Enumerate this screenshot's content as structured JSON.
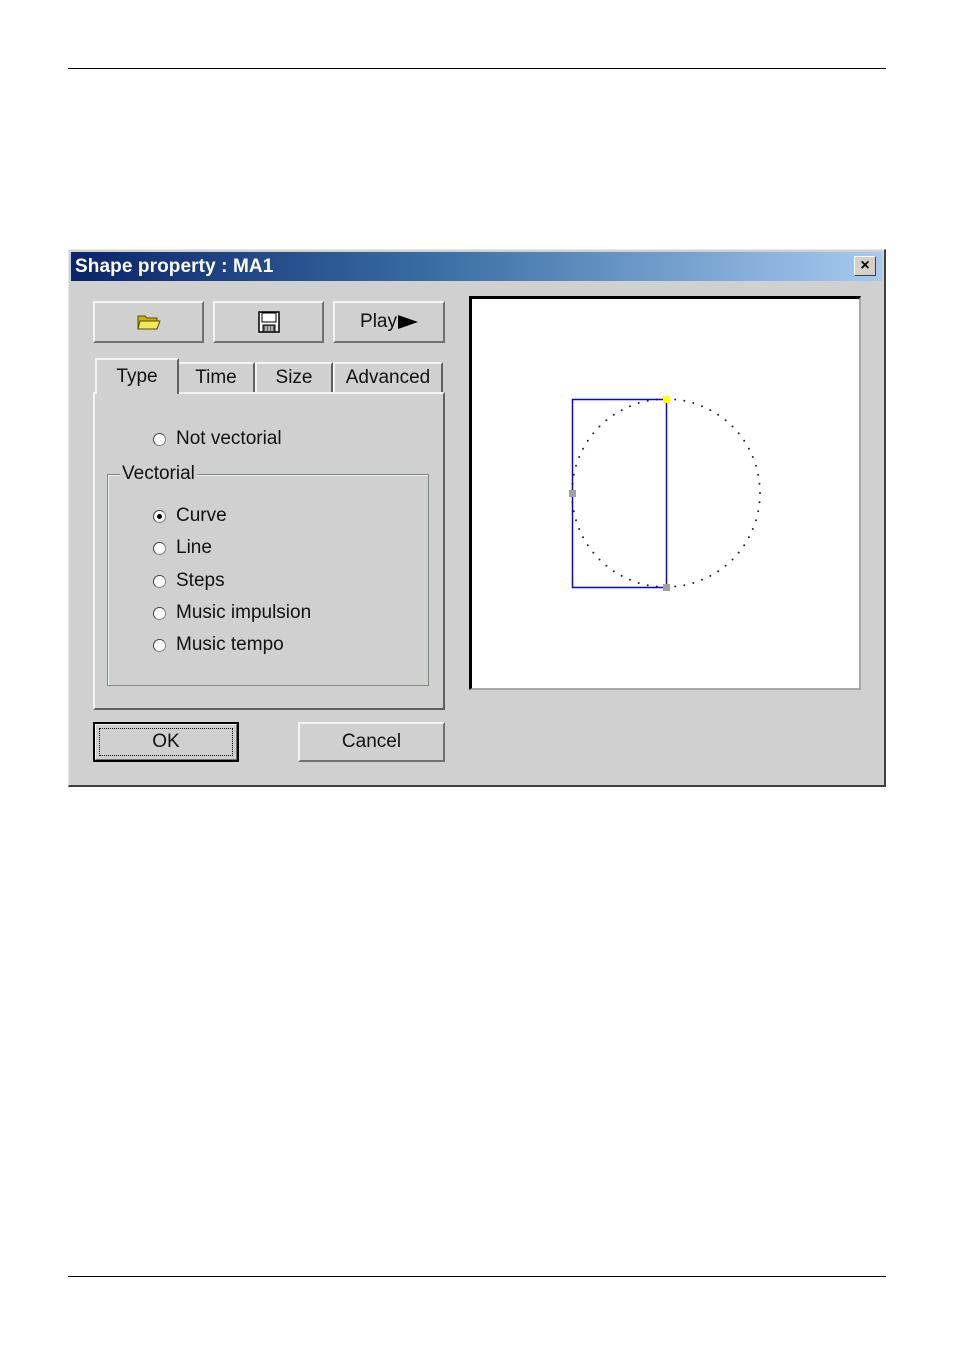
{
  "dialog": {
    "title": "Shape property : MA1",
    "close_label": "×",
    "toolbar": {
      "open_icon": "folder-open-icon",
      "save_icon": "floppy-disk-icon",
      "play_label": "Play",
      "play_icon": "play-arrow-icon"
    },
    "tabs": [
      {
        "label": "Type",
        "active": true
      },
      {
        "label": "Time",
        "active": false
      },
      {
        "label": "Size",
        "active": false
      },
      {
        "label": "Advanced",
        "active": false
      }
    ],
    "type_panel": {
      "not_vectorial": {
        "label": "Not vectorial",
        "checked": false
      },
      "vectorial_group": {
        "label": "Vectorial",
        "options": [
          {
            "label": "Curve",
            "checked": true
          },
          {
            "label": "Line",
            "checked": false
          },
          {
            "label": "Steps",
            "checked": false
          },
          {
            "label": "Music impulsion",
            "checked": false
          },
          {
            "label": "Music tempo",
            "checked": false
          }
        ]
      }
    },
    "buttons": {
      "ok_label": "OK",
      "cancel_label": "Cancel"
    },
    "preview": {
      "shape": "circle-dotted",
      "selection_color": "#0000ff",
      "handle_active_color": "#ffff00",
      "handle_color": "#a0a0a0"
    }
  }
}
